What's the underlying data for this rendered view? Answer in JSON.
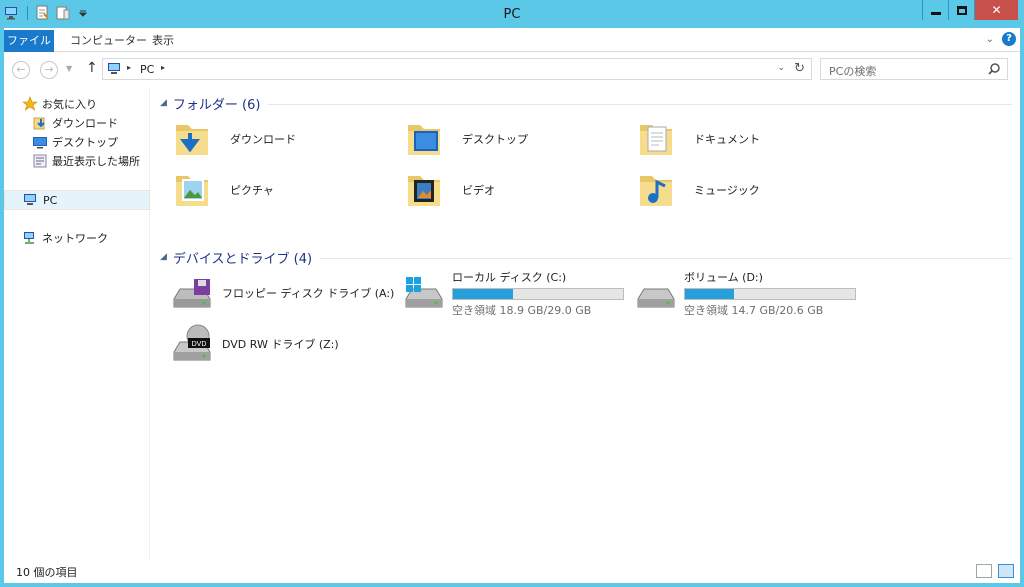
{
  "window": {
    "title": "PC",
    "minimize": "",
    "maximize": "",
    "close": "✕"
  },
  "ribbon": {
    "tabs": [
      "ファイル",
      "コンピューター",
      "表示"
    ],
    "help": "?"
  },
  "nav": {
    "address_root_arrow": "▸",
    "address_text": "PC",
    "address_arrow2": "▸",
    "search_placeholder": "PCの検索"
  },
  "sidebar": {
    "items": [
      {
        "label": "お気に入り",
        "icon": "star-icon"
      },
      {
        "label": "ダウンロード",
        "icon": "downloads-icon"
      },
      {
        "label": "デスクトップ",
        "icon": "desktop-icon"
      },
      {
        "label": "最近表示した場所",
        "icon": "recent-places-icon"
      },
      {
        "label": "PC",
        "icon": "pc-icon"
      },
      {
        "label": "ネットワーク",
        "icon": "network-icon"
      }
    ]
  },
  "folders": {
    "header": "フォルダー (6)",
    "items": [
      {
        "label": "ダウンロード",
        "icon": "folder-download-icon"
      },
      {
        "label": "デスクトップ",
        "icon": "folder-desktop-icon"
      },
      {
        "label": "ドキュメント",
        "icon": "folder-documents-icon"
      },
      {
        "label": "ピクチャ",
        "icon": "folder-pictures-icon"
      },
      {
        "label": "ビデオ",
        "icon": "folder-videos-icon"
      },
      {
        "label": "ミュージック",
        "icon": "folder-music-icon"
      }
    ]
  },
  "devices": {
    "header": "デバイスとドライブ (4)",
    "items": [
      {
        "label": "フロッピー ディスク ドライブ (A:)",
        "icon": "floppy-drive-icon"
      },
      {
        "label": "ローカル ディスク (C:)",
        "icon": "local-disk-icon",
        "free": "空き領域 18.9 GB/29.0 GB",
        "used_fraction": 0.35
      },
      {
        "label": "ボリューム (D:)",
        "icon": "volume-drive-icon",
        "free": "空き領域 14.7 GB/20.6 GB",
        "used_fraction": 0.29
      },
      {
        "label": "DVD RW ドライブ (Z:)",
        "icon": "dvd-drive-icon"
      }
    ]
  },
  "status": {
    "count": "10 個の項目"
  },
  "colors": {
    "titlebar": "#5cc8e8",
    "file_tab": "#1979ca",
    "group_title": "#1e3287",
    "drive_fill": "#26a0da",
    "close": "#c7504a"
  }
}
